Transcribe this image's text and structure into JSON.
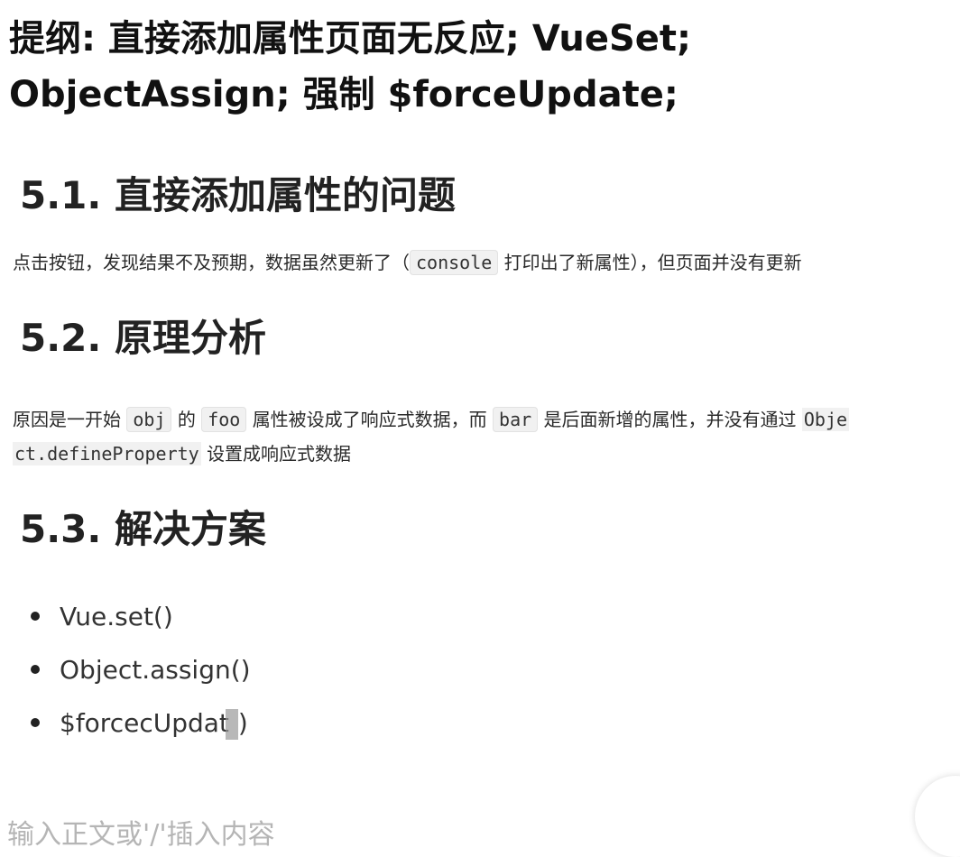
{
  "outline": {
    "line1": "提纲: 直接添加属性页面无反应; VueSet;",
    "line2": "ObjectAssign; 强制 $forceUpdate;"
  },
  "section1": {
    "title": "5.1. 直接添加属性的问题",
    "text_before": "点击按钮，发现结果不及预期，数据虽然更新了（",
    "code": "console",
    "text_after": "打印出了新属性），但页面并没有更新"
  },
  "section2": {
    "title": "5.2. 原理分析",
    "part1": "原因是一开始",
    "code1": "obj",
    "part2": "的",
    "code2": "foo",
    "part3": "属性被设成了响应式数据，而",
    "code3": "bar",
    "part4": "是后面新增的属性，并没有通过",
    "code4a": "Obje",
    "code4b": "ct.defineProperty",
    "part5": "设置成响应式数据"
  },
  "section3": {
    "title": "5.3. 解决方案",
    "items": [
      "Vue.set()",
      "Object.assign()",
      "$forcecUpdat",
      ")"
    ]
  },
  "editor": {
    "placeholder": "输入正文或'/'插入内容"
  }
}
